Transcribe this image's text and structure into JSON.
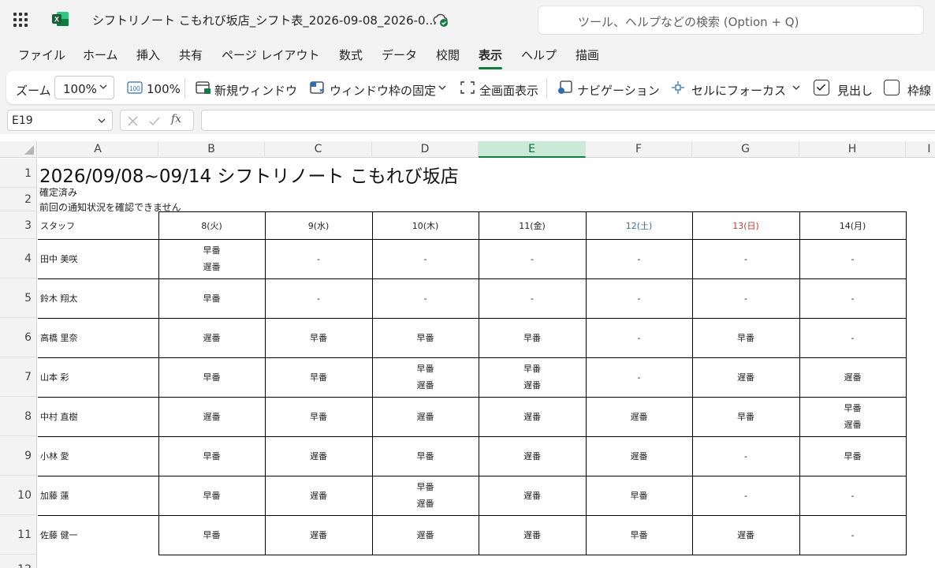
{
  "titlebar": {
    "doc_title": "シフトリノート こもれび坂店_シフト表_2026-09-08_2026-0...",
    "search_placeholder": "ツール、ヘルプなどの検索 (Option + Q)"
  },
  "menu": {
    "tabs": [
      "ファイル",
      "ホーム",
      "挿入",
      "共有",
      "ページ レイアウト",
      "数式",
      "データ",
      "校閲",
      "表示",
      "ヘルプ",
      "描画"
    ],
    "active": "表示"
  },
  "ribbon": {
    "zoom_label": "ズーム",
    "zoom_value": "100%",
    "zoom100_label": "100%",
    "new_window": "新規ウィンドウ",
    "freeze_panes": "ウィンドウ枠の固定",
    "fullscreen": "全画面表示",
    "navigation": "ナビゲーション",
    "focus_cell": "セルにフォーカス",
    "headings": "見出し",
    "gridlines": "枠線"
  },
  "formula_bar": {
    "name_box": "E19",
    "fx_label": "fx",
    "formula": ""
  },
  "sheet": {
    "columns": [
      "A",
      "B",
      "C",
      "D",
      "E",
      "F",
      "G",
      "H",
      "I"
    ],
    "selected_column": "E",
    "rows": [
      "1",
      "2",
      "3",
      "4",
      "5",
      "6",
      "7",
      "8",
      "9",
      "10",
      "11",
      "12"
    ],
    "title": "2026/09/08~09/14 シフトリノート こもれび坂店",
    "status": "確定済み",
    "notice": "前回の通知状況を確認できません",
    "header": {
      "staff": "スタッフ",
      "days": [
        "8(火)",
        "9(水)",
        "10(木)",
        "11(金)",
        "12(土)",
        "13(日)",
        "14(月)"
      ]
    },
    "day_colors": [
      "#222222",
      "#222222",
      "#222222",
      "#222222",
      "#2f6eb5",
      "#c0392b",
      "#222222"
    ],
    "staff_rows": [
      {
        "name": "田中 美咲",
        "shifts": [
          [
            "早番",
            "遅番"
          ],
          [
            "-"
          ],
          [
            "-"
          ],
          [
            "-"
          ],
          [
            "-"
          ],
          [
            "-"
          ],
          [
            "-"
          ]
        ]
      },
      {
        "name": "鈴木 翔太",
        "shifts": [
          [
            "早番"
          ],
          [
            "-"
          ],
          [
            "-"
          ],
          [
            "-"
          ],
          [
            "-"
          ],
          [
            "-"
          ],
          [
            "-"
          ]
        ]
      },
      {
        "name": "高橋 里奈",
        "shifts": [
          [
            "遅番"
          ],
          [
            "早番"
          ],
          [
            "早番"
          ],
          [
            "早番"
          ],
          [
            "-"
          ],
          [
            "早番"
          ],
          [
            "-"
          ]
        ]
      },
      {
        "name": "山本 彩",
        "shifts": [
          [
            "早番"
          ],
          [
            "早番"
          ],
          [
            "早番",
            "遅番"
          ],
          [
            "早番",
            "遅番"
          ],
          [
            "-"
          ],
          [
            "遅番"
          ],
          [
            "遅番"
          ]
        ]
      },
      {
        "name": "中村 直樹",
        "shifts": [
          [
            "遅番"
          ],
          [
            "早番"
          ],
          [
            "遅番"
          ],
          [
            "遅番"
          ],
          [
            "遅番"
          ],
          [
            "早番"
          ],
          [
            "早番",
            "遅番"
          ]
        ]
      },
      {
        "name": "小林 愛",
        "shifts": [
          [
            "早番"
          ],
          [
            "遅番"
          ],
          [
            "早番"
          ],
          [
            "遅番"
          ],
          [
            "遅番"
          ],
          [
            "-"
          ],
          [
            "早番"
          ]
        ]
      },
      {
        "name": "加藤 蓮",
        "shifts": [
          [
            "早番"
          ],
          [
            "遅番"
          ],
          [
            "早番",
            "遅番"
          ],
          [
            "遅番"
          ],
          [
            "早番"
          ],
          [
            "-"
          ],
          [
            "-"
          ]
        ]
      },
      {
        "name": "佐藤 健一",
        "shifts": [
          [
            "早番"
          ],
          [
            "遅番"
          ],
          [
            "遅番"
          ],
          [
            "遅番"
          ],
          [
            "早番"
          ],
          [
            "遅番"
          ],
          [
            "-"
          ]
        ]
      }
    ]
  }
}
